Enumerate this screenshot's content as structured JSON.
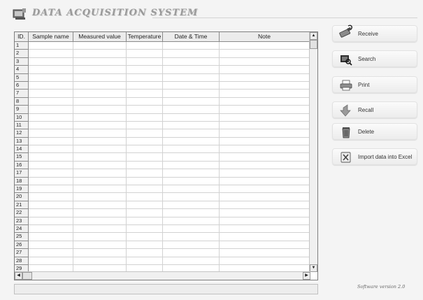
{
  "app": {
    "title": "DATA ACQUISITION SYSTEM",
    "version": "Software version 2.0"
  },
  "table": {
    "columns": [
      {
        "label": "ID."
      },
      {
        "label": "Sample name"
      },
      {
        "label": "Measured value"
      },
      {
        "label": "Temperature"
      },
      {
        "label": "Date & Time"
      },
      {
        "label": "Note"
      }
    ],
    "row_ids": [
      "1",
      "2",
      "3",
      "4",
      "5",
      "6",
      "7",
      "8",
      "9",
      "10",
      "11",
      "12",
      "13",
      "14",
      "15",
      "16",
      "17",
      "18",
      "19",
      "20",
      "21",
      "22",
      "23",
      "24",
      "25",
      "26",
      "27",
      "28",
      "29"
    ]
  },
  "actions": {
    "receive": "Receive",
    "search": "Search",
    "print": "Print",
    "recall": "Recall",
    "delete": "Delete",
    "import_excel": "Import data into Excel"
  },
  "icons": [
    "app-logo-icon",
    "usb-cable-icon",
    "search-icon",
    "printer-icon",
    "recall-arrow-icon",
    "trash-icon",
    "excel-icon"
  ],
  "colors": {
    "title": "#9a9a9a",
    "grid_line": "#d2d2d2",
    "header_bg": "#ececec"
  }
}
